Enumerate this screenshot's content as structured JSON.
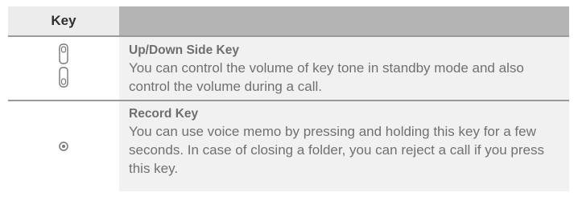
{
  "table": {
    "header": {
      "key_label": "Key",
      "description_label": ""
    },
    "rows": [
      {
        "icon": "up-down-side-key-icon",
        "title": "Up/Down Side Key",
        "description": "You can control the volume of key tone in standby mode and also control the volume during a call."
      },
      {
        "icon": "record-key-icon",
        "title": "Record Key",
        "description": "You can use voice memo by pressing and holding this key for a few seconds. In case of closing a folder, you can reject a call if you press this key."
      }
    ]
  },
  "colors": {
    "header_key_bg": "#ececec",
    "header_desc_bg": "#b4b4b4",
    "description_bg": "#f1f1f1",
    "text": "#707070",
    "divider": "#9a9a9a"
  }
}
